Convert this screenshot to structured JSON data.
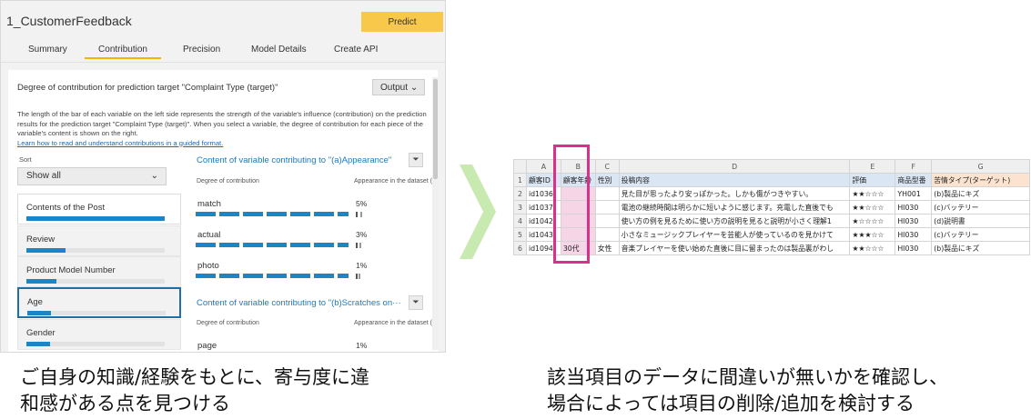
{
  "app": {
    "title": "1_CustomerFeedback",
    "predict_label": "Predict",
    "tabs": [
      "Summary",
      "Contribution",
      "Precision",
      "Model Details",
      "Create API"
    ],
    "active_tab": "Contribution",
    "panel_title": "Degree of contribution for prediction target \"Complaint Type (target)\"",
    "output_label": "Output",
    "description": "The length of the bar of each variable on the left side represents the strength of the variable's influence (contribution) on the prediction results for the prediction target \"Complaint Type (target)\". When you select a variable, the degree of contribution for each piece of the variable's content is shown on the right.",
    "guide_link": "Learn how to read and understand contributions in a guided format.",
    "sort_label": "Sort",
    "sort_value": "Show all",
    "variables": [
      {
        "label": "Contents of the Post",
        "contribution": 1.0
      },
      {
        "label": "Review",
        "contribution": 0.28
      },
      {
        "label": "Product Model Number",
        "contribution": 0.22
      },
      {
        "label": "Age",
        "contribution": 0.17
      },
      {
        "label": "Gender",
        "contribution": 0.17
      }
    ],
    "selected_variable": "Age",
    "sections": [
      {
        "title": "Content of variable contributing to \"(a)Appearance\"",
        "col_contribution": "Degree of contribution",
        "col_appearance": "Appearance in the dataset (",
        "rows": [
          {
            "word": "match",
            "pct": "5%",
            "appearance": 0.05
          },
          {
            "word": "actual",
            "pct": "3%",
            "appearance": 0.03
          },
          {
            "word": "photo",
            "pct": "1%",
            "appearance": 0.01
          }
        ]
      },
      {
        "title": "Content of variable contributing to \"(b)Scratches on···",
        "col_contribution": "Degree of contribution",
        "col_appearance": "Appearance in the dataset (",
        "rows": [
          {
            "word": "page",
            "pct": "1%",
            "appearance": 0.01
          }
        ]
      }
    ]
  },
  "sheet": {
    "col_letters": [
      "A",
      "B",
      "C",
      "D",
      "E",
      "F",
      "G"
    ],
    "headers": [
      "顧客ID",
      "顧客年齢",
      "性別",
      "投稿内容",
      "評価",
      "商品型番",
      "苦情タイプ(ターゲット)"
    ],
    "rows": [
      {
        "num": "2",
        "cells": [
          "id1036",
          "",
          "",
          "見た目が思ったより安っぽかった。しかも傷がつきやすい。",
          "★★☆☆☆",
          "YH001",
          "(b)製品にキズ"
        ]
      },
      {
        "num": "3",
        "cells": [
          "id1037",
          "",
          "",
          "電池の継続時間は明らかに短いように感じます。充電した直後でも",
          "★★☆☆☆",
          "HI030",
          "(c)バッテリー"
        ]
      },
      {
        "num": "4",
        "cells": [
          "id1042",
          "",
          "",
          "使い方の例を見るために使い方の説明を見ると説明が小さく理解1",
          "★☆☆☆☆",
          "HI030",
          "(d)説明書"
        ]
      },
      {
        "num": "5",
        "cells": [
          "id1043",
          "",
          "",
          "小さなミュージックプレイヤーを芸能人が使っているのを見かけて",
          "★★★☆☆",
          "HI030",
          "(c)バッテリー"
        ]
      },
      {
        "num": "6",
        "cells": [
          "id1094",
          "30代",
          "女性",
          "音楽プレイヤーを使い始めた直後に目に留まったのは製品裏がわし",
          "★★☆☆☆",
          "HI030",
          "(b)製品にキズ"
        ]
      }
    ],
    "header_row_num": "1"
  },
  "captions": {
    "left_line1": "ご自身の知識/経験をもとに、寄与度に違",
    "left_line2": "和感がある点を見つける",
    "right_line1": "該当項目のデータに間違いが無いかを確認し、",
    "right_line2": "場合によっては項目の削除/追加を検討する"
  },
  "colors": {
    "accent_blue": "#1a86c8",
    "predict_yellow": "#f7c84a",
    "highlight_pink": "#d8318a",
    "arrow_green": "#c8eab0"
  }
}
